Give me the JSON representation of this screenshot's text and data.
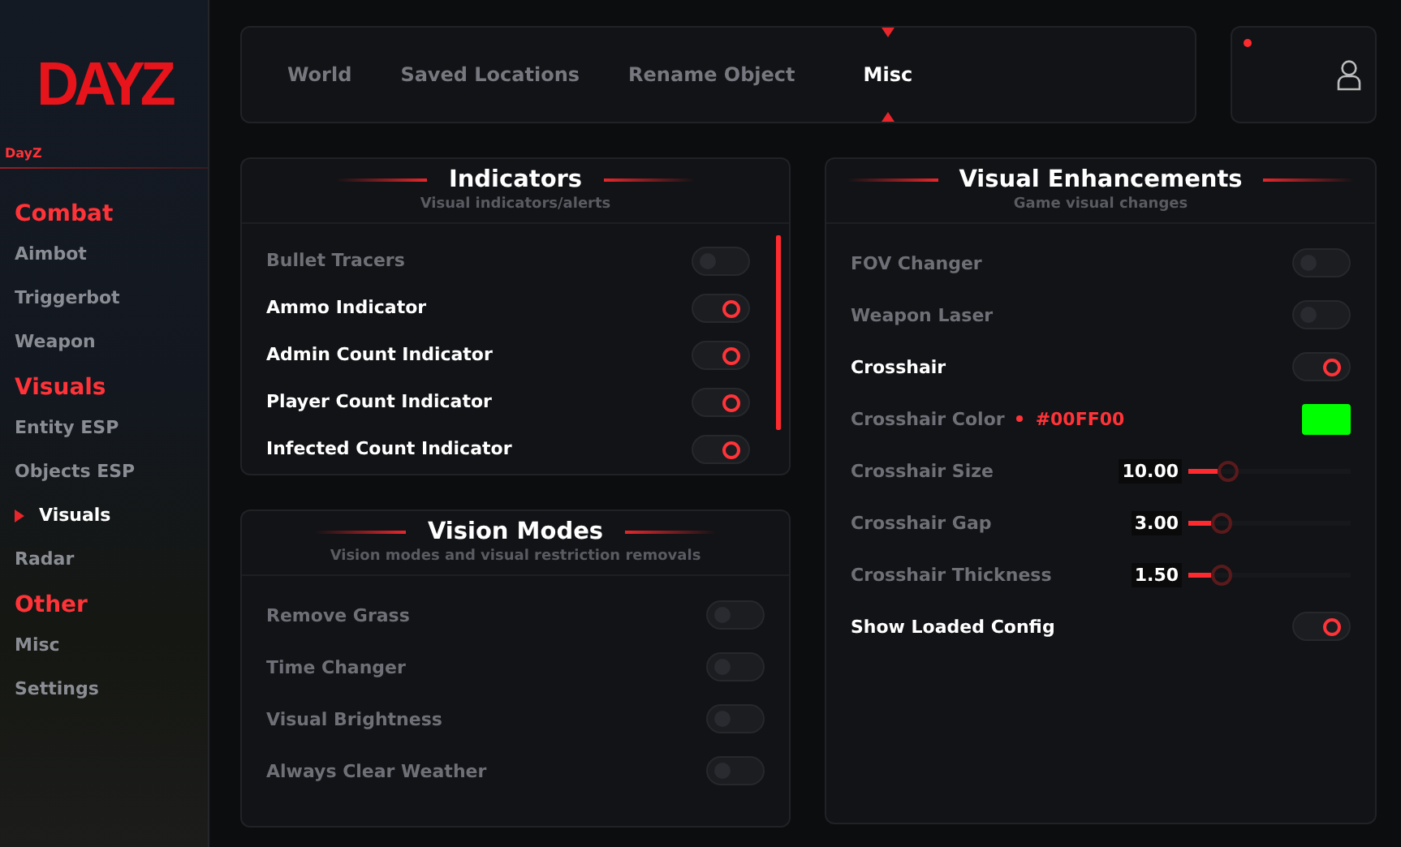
{
  "sidebar": {
    "logo": "DAYZ",
    "game": "DayZ",
    "sections": [
      {
        "title": "Combat",
        "items": [
          {
            "label": "Aimbot",
            "selected": false
          },
          {
            "label": "Triggerbot",
            "selected": false
          },
          {
            "label": "Weapon",
            "selected": false
          }
        ]
      },
      {
        "title": "Visuals",
        "items": [
          {
            "label": "Entity ESP",
            "selected": false
          },
          {
            "label": "Objects ESP",
            "selected": false
          },
          {
            "label": "Visuals",
            "selected": true
          },
          {
            "label": "Radar",
            "selected": false
          }
        ]
      },
      {
        "title": "Other",
        "items": [
          {
            "label": "Misc",
            "selected": false
          },
          {
            "label": "Settings",
            "selected": false
          }
        ]
      }
    ]
  },
  "tabs": [
    {
      "label": "World",
      "selected": false
    },
    {
      "label": "Saved Locations",
      "selected": false
    },
    {
      "label": "Rename Object",
      "selected": false
    },
    {
      "label": "Misc",
      "selected": true
    }
  ],
  "user": {
    "notification": true
  },
  "panels": [
    {
      "title": "Indicators",
      "subtitle": "Visual indicators/alerts",
      "scrollable": true,
      "rows": [
        {
          "kind": "toggle",
          "label": "Bullet Tracers",
          "on": false
        },
        {
          "kind": "toggle",
          "label": "Ammo Indicator",
          "on": true
        },
        {
          "kind": "toggle",
          "label": "Admin Count Indicator",
          "on": true
        },
        {
          "kind": "toggle",
          "label": "Player Count Indicator",
          "on": true
        },
        {
          "kind": "toggle",
          "label": "Infected Count Indicator",
          "on": true
        }
      ]
    },
    {
      "title": "Vision Modes",
      "subtitle": "Vision modes and visual restriction removals",
      "scrollable": false,
      "rows": [
        {
          "kind": "toggle",
          "label": "Remove Grass",
          "on": false
        },
        {
          "kind": "toggle",
          "label": "Time Changer",
          "on": false
        },
        {
          "kind": "toggle",
          "label": "Visual Brightness",
          "on": false
        },
        {
          "kind": "toggle",
          "label": "Always Clear Weather",
          "on": false
        }
      ]
    },
    {
      "title": "Visual Enhancements",
      "subtitle": "Game visual changes",
      "scrollable": false,
      "rows": [
        {
          "kind": "toggle",
          "label": "FOV Changer",
          "on": false
        },
        {
          "kind": "toggle",
          "label": "Weapon Laser",
          "on": false
        },
        {
          "kind": "toggle",
          "label": "Crosshair",
          "on": true
        },
        {
          "kind": "color",
          "label": "Crosshair Color",
          "value": "#00FF00",
          "color": "#00ff00"
        },
        {
          "kind": "slider",
          "label": "Crosshair Size",
          "reading": "10.00",
          "level": 0.18
        },
        {
          "kind": "slider",
          "label": "Crosshair Gap",
          "reading": "3.00",
          "level": 0.14
        },
        {
          "kind": "slider",
          "label": "Crosshair Thickness",
          "reading": "1.50",
          "level": 0.14
        },
        {
          "kind": "toggle",
          "label": "Show Loaded Config",
          "on": true
        }
      ]
    }
  ]
}
